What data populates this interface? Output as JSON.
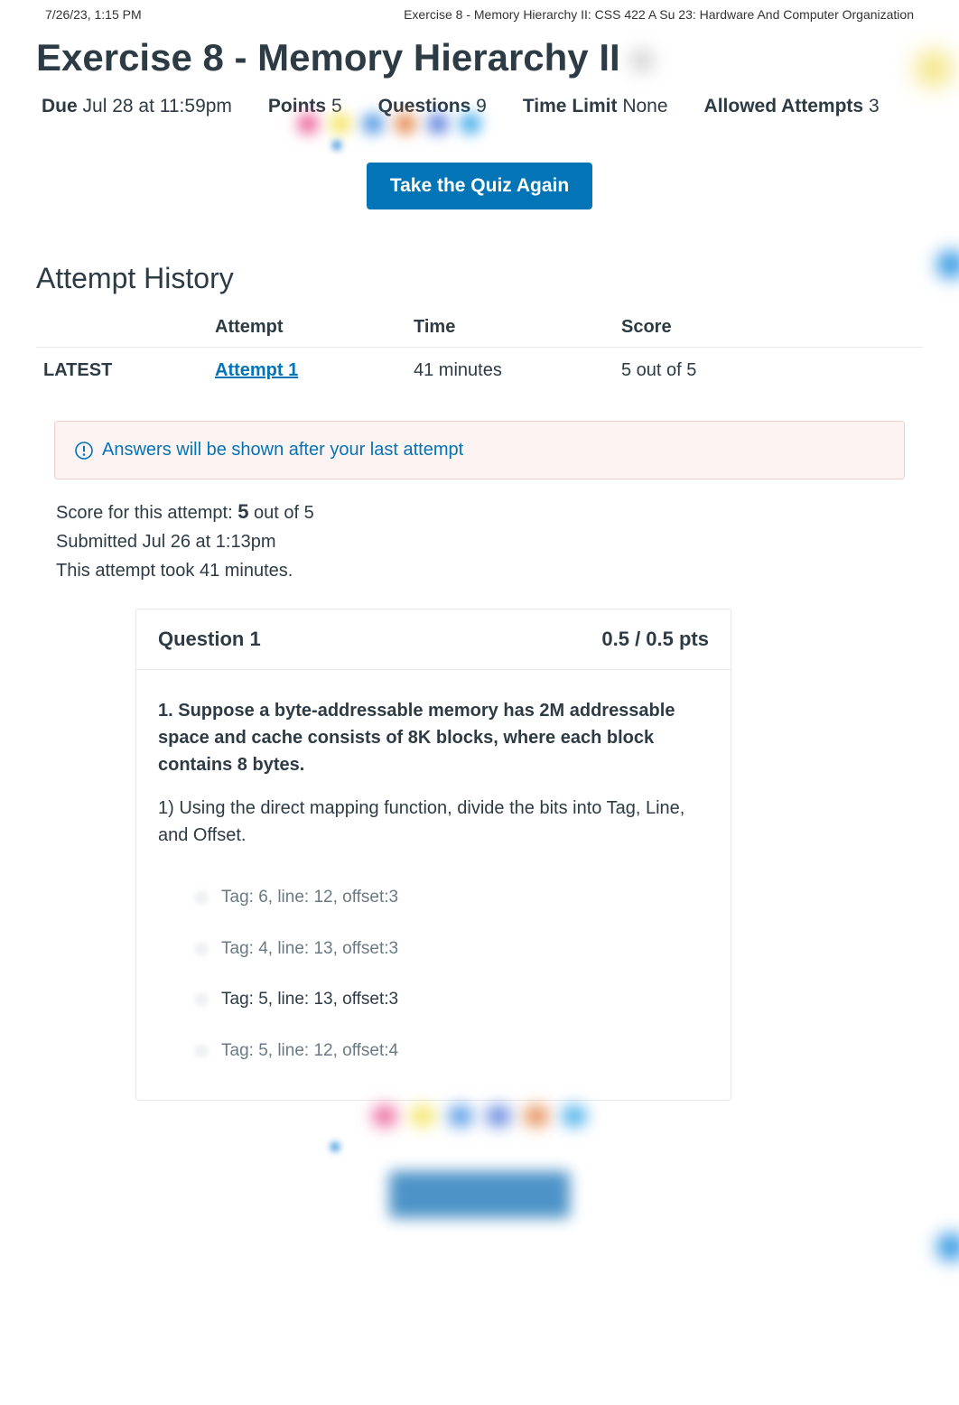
{
  "print": {
    "left": "7/26/23, 1:15 PM",
    "right": "Exercise 8 - Memory Hierarchy II: CSS 422 A Su 23: Hardware And Computer Organization"
  },
  "title": "Exercise 8 - Memory Hierarchy II",
  "meta": [
    {
      "label": "Due",
      "value": "Jul 28 at 11:59pm"
    },
    {
      "label": "Points",
      "value": "5"
    },
    {
      "label": "Questions",
      "value": "9"
    },
    {
      "label": "Time Limit",
      "value": "None"
    },
    {
      "label": "Allowed Attempts",
      "value": "3"
    }
  ],
  "take_again": "Take the Quiz Again",
  "history": {
    "heading": "Attempt History",
    "columns": [
      "",
      "Attempt",
      "Time",
      "Score"
    ],
    "rows": [
      {
        "status": "LATEST",
        "attempt": "Attempt 1",
        "time": "41 minutes",
        "score": "5 out of 5"
      }
    ]
  },
  "alert": "Answers will be shown after your last attempt",
  "summary": {
    "score_prefix": "Score for this attempt: ",
    "score": "5",
    "score_suffix": " out of 5",
    "submitted": "Submitted Jul 26 at 1:13pm",
    "duration": "This attempt took 41 minutes."
  },
  "question1": {
    "title": "Question 1",
    "pts": "0.5 / 0.5 pts",
    "bold": "1. Suppose a byte-addressable memory has 2M addressable space and cache consists of 8K blocks, where each block contains 8 bytes.",
    "sub": "1) Using the direct mapping function, divide the bits into Tag, Line, and Offset.",
    "answers": [
      {
        "text": "Tag: 6, line: 12, offset:3",
        "selected": false
      },
      {
        "text": "Tag: 4, line: 13, offset:3",
        "selected": false
      },
      {
        "text": "Tag: 5, line: 13, offset:3",
        "selected": true
      },
      {
        "text": "Tag: 5, line: 12, offset:4",
        "selected": false
      }
    ]
  }
}
